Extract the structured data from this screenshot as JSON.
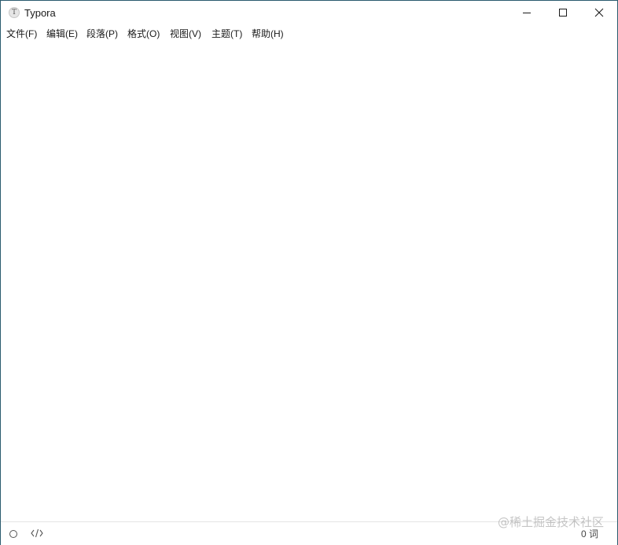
{
  "window": {
    "title": "Typora",
    "icon": "typora-app-icon",
    "icon_glyph": "T"
  },
  "controls": {
    "minimize": "minimize-icon",
    "maximize": "maximize-icon",
    "close": "close-icon"
  },
  "menu": {
    "items": [
      {
        "label": "文件(F)"
      },
      {
        "label": "编辑(E)"
      },
      {
        "label": "段落(P)"
      },
      {
        "label": "格式(O)"
      },
      {
        "label": "视图(V)"
      },
      {
        "label": "主题(T)"
      },
      {
        "label": "帮助(H)"
      }
    ]
  },
  "editor": {
    "content": ""
  },
  "status": {
    "outline_icon": "outline-circle-icon",
    "source_icon": "source-code-icon",
    "word_count": "0 词"
  },
  "watermark": "@稀土掘金技术社区",
  "colors": {
    "window_border": "#2b5b6e",
    "background": "#ffffff",
    "text": "#1a1a1a"
  }
}
